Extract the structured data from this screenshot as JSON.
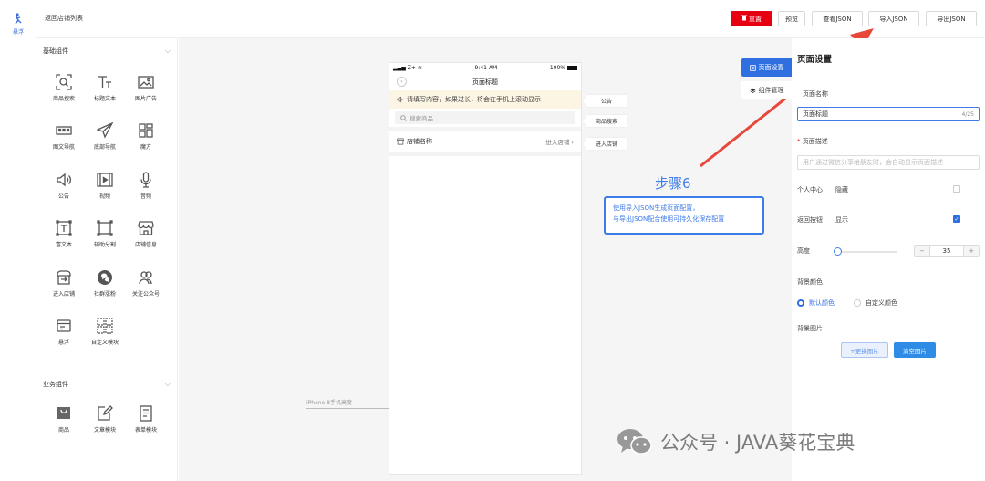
{
  "rail": {
    "label": "悬浮",
    "active_color": "#3b6fd6"
  },
  "header": {
    "back_link": "返回店铺列表",
    "buttons": {
      "reset": "重置",
      "preview": "预览",
      "view_json": "查看JSON",
      "import_json": "导入JSON",
      "export_json": "导出JSON"
    },
    "reset_color": "#e60012"
  },
  "components": {
    "basic_title": "基础组件",
    "basic": [
      {
        "label": "商品搜索",
        "icon": "scan-search-icon"
      },
      {
        "label": "标题文本",
        "icon": "text-title-icon"
      },
      {
        "label": "图片广告",
        "icon": "image-ad-icon"
      },
      {
        "label": "图文导航",
        "icon": "image-nav-icon"
      },
      {
        "label": "底部导航",
        "icon": "paper-plane-icon"
      },
      {
        "label": "魔方",
        "icon": "grid-cube-icon"
      },
      {
        "label": "公告",
        "icon": "speaker-icon"
      },
      {
        "label": "视频",
        "icon": "video-icon"
      },
      {
        "label": "音频",
        "icon": "microphone-icon"
      },
      {
        "label": "富文本",
        "icon": "rich-text-icon"
      },
      {
        "label": "辅助分割",
        "icon": "divider-icon"
      },
      {
        "label": "店铺信息",
        "icon": "store-icon"
      },
      {
        "label": "进入店铺",
        "icon": "enter-store-icon"
      },
      {
        "label": "社群涨粉",
        "icon": "group-fans-icon"
      },
      {
        "label": "关注公众号",
        "icon": "follow-account-icon"
      },
      {
        "label": "悬浮",
        "icon": "float-icon"
      },
      {
        "label": "自定义模块",
        "icon": "custom-module-icon"
      }
    ],
    "business_title": "业务组件",
    "business": [
      {
        "label": "商品",
        "icon": "goods-bag-icon"
      },
      {
        "label": "文章模块",
        "icon": "article-icon"
      },
      {
        "label": "表单模块",
        "icon": "form-icon"
      }
    ]
  },
  "phone": {
    "signal": "Z+",
    "time": "9:41 AM",
    "battery": "100%",
    "title": "页面标题",
    "notice": "请填写内容，如果过长，将会在手机上滚动显示",
    "search_placeholder": "搜索商品",
    "shop_name": "店铺名称",
    "enter_shop": "进入店铺",
    "device_label": "iPhone 8手机高度"
  },
  "side_tags": {
    "notice": "公告",
    "search": "商品搜索",
    "enter": "进入店铺"
  },
  "annotation": {
    "step": "步骤6",
    "line1": "使用导入JSON生成页面配置，",
    "line2": "与导出JSON配合使用可持久化保存配置",
    "color": "#3d7ce8",
    "arrow_color": "#e8483b"
  },
  "tabs": {
    "page_settings": "页面设置",
    "component_manage": "组件管理"
  },
  "settings": {
    "title": "页面设置",
    "page_name_label": "页面名称",
    "page_name_value": "页面标题",
    "page_name_count": "4/25",
    "page_desc_label": "页面描述",
    "page_desc_placeholder": "用户通过微信分享给朋友时，会自动显示页面描述",
    "personal_center_label": "个人中心",
    "personal_center_value": "隐藏",
    "personal_center_checked": false,
    "back_button_label": "返回按钮",
    "back_button_value": "显示",
    "back_button_checked": true,
    "height_label": "高度",
    "height_value": "35",
    "bg_color_label": "背景颜色",
    "bg_default": "默认颜色",
    "bg_custom": "自定义颜色",
    "bg_image_label": "背景图片",
    "btn_change_image": "+更换图片",
    "btn_clear_image": "清空图片"
  },
  "watermark": {
    "text": "公众号 · JAVA葵花宝典"
  }
}
